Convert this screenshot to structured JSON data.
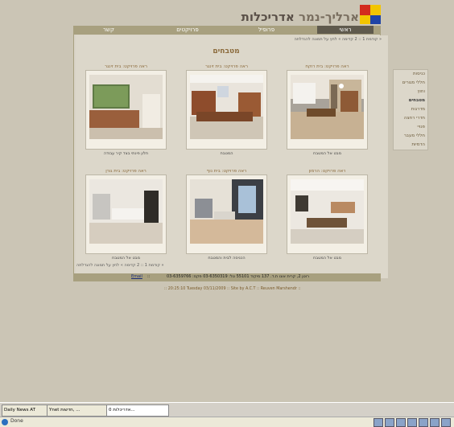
{
  "header": {
    "logo_text_main": "ארליך-נמר ",
    "logo_text_accent": "אדריכלות"
  },
  "nav": {
    "tabs": [
      {
        "label": "ראשי",
        "active": true
      },
      {
        "label": "פרופיל",
        "active": false
      },
      {
        "label": "פרויקטים",
        "active": false
      },
      {
        "label": "קשר",
        "active": false
      }
    ]
  },
  "breadcrumb": {
    "text": "« קודמת 1 :: 2 קדימה »  לחץ על תמונה להגדלתה"
  },
  "page_title": "מטבחים",
  "side_menu": {
    "items": [
      {
        "label": "כניסות",
        "active": false
      },
      {
        "label": "חללי מגורים",
        "active": false
      },
      {
        "label": "וחוץ",
        "active": false
      },
      {
        "label": "מטבחים",
        "active": true
      },
      {
        "label": "מדרגות",
        "active": false
      },
      {
        "label": "חדרי רחצה",
        "active": false
      },
      {
        "label": "פנויי",
        "active": false
      },
      {
        "label": "חללי מעבר",
        "active": false
      },
      {
        "label": "הדמיות",
        "active": false
      }
    ]
  },
  "thumbnails": [
    {
      "top": "ראה פרויקט: בית רוקח",
      "bottom": "מבט אל המטבח"
    },
    {
      "top": "ראה פרויקט: בית זינגר",
      "bottom": "המטבח"
    },
    {
      "top": "ראה פרויקט: בית זינגר",
      "bottom": "חלון פינתי בצד קיר עבודה"
    },
    {
      "top": "ראה פרויקט: הרמון",
      "bottom": "מבט אל המטבח"
    },
    {
      "top": "ראה פרויקט: בית נוף",
      "bottom": "הכניסה לבית והמטבח"
    },
    {
      "top": "ראה פרויקט: בית גורן",
      "bottom": "מבט אל המטבח"
    }
  ],
  "pager_bottom": "« קודמת 1 :: 2 קדימה »  לחץ על תמונה להגדלתה",
  "footer": {
    "address": "רוטן 2, קרית אונו ת.ד. 137 מיקוד 55101 טל: 03-6350319 פקס: 03-6359766",
    "email": "Email",
    "credit": ":: 20:25:10 Tuesday 03/11/2009 :: Site by A.C.T :: Reuven Marshendr ::"
  },
  "taskbar": {
    "buttons": [
      {
        "label": "Daily News AT",
        "active": false
      },
      {
        "label": "Ynet חדשות, ...",
        "active": false
      },
      {
        "label": "אדריכלות 0...",
        "active": true
      }
    ],
    "status": "Done"
  },
  "colors": {
    "nav_bg": "#a8a07f",
    "nav_active": "#5f5a4d",
    "title": "#8b6a3b",
    "logo_red": "#d32a1e",
    "logo_yellow": "#f2c500",
    "logo_blue": "#1f44a6"
  }
}
